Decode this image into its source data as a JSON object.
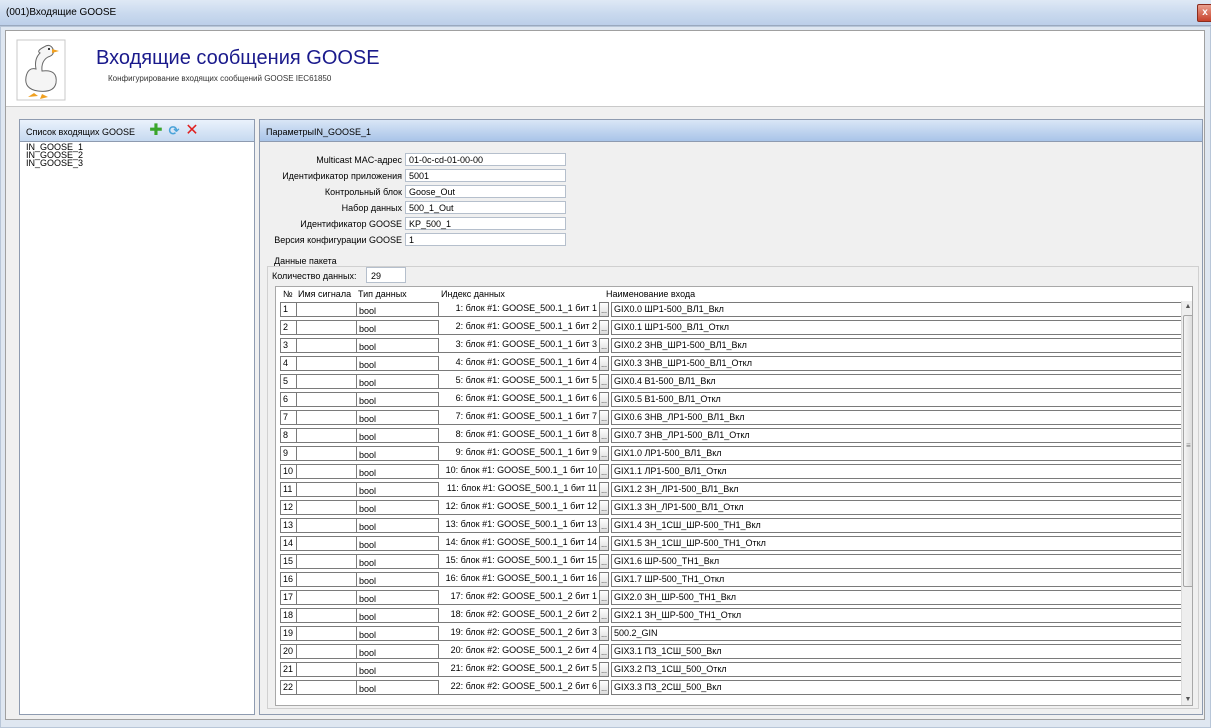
{
  "window": {
    "title": "(001)Входящие GOOSE",
    "close": "x"
  },
  "header": {
    "title": "Входящие сообщения GOOSE",
    "subtitle": "Конфигурирование входящих сообщений GOOSE IEC61850"
  },
  "left": {
    "title": "Список входящих GOOSE",
    "items": [
      "IN_GOOSE_1",
      "IN_GOOSE_2",
      "IN_GOOSE_3"
    ]
  },
  "right": {
    "title": "ПараметрыIN_GOOSE_1",
    "fields": {
      "mac": {
        "label": "Multicast MAC-адрес",
        "value": "01-0c-cd-01-00-00"
      },
      "appid": {
        "label": "Идентификатор приложения",
        "value": "5001"
      },
      "cb": {
        "label": "Контрольный блок",
        "value": "Goose_Out"
      },
      "dataset": {
        "label": "Набор данных",
        "value": "500_1_Out"
      },
      "gooseid": {
        "label": "Идентификатор GOOSE",
        "value": "KP_500_1"
      },
      "confrev": {
        "label": "Версия конфигурации GOOSE",
        "value": "1"
      }
    },
    "packet": {
      "title": "Данные пакета",
      "count_label": "Количество данных:",
      "count": "29"
    },
    "grid": {
      "headers": [
        "№",
        "Имя сигнала",
        "Тип данных",
        "Индекс данных",
        "Наименование входа"
      ],
      "btn": "...",
      "rows": [
        {
          "n": "1",
          "name": "",
          "type": "bool",
          "index": "1: блок #1: GOOSE_500.1_1 бит 1",
          "input": "GIX0.0 ШР1-500_ВЛ1_Вкл"
        },
        {
          "n": "2",
          "name": "",
          "type": "bool",
          "index": "2: блок #1: GOOSE_500.1_1 бит 2",
          "input": "GIX0.1 ШР1-500_ВЛ1_Откл"
        },
        {
          "n": "3",
          "name": "",
          "type": "bool",
          "index": "3: блок #1: GOOSE_500.1_1 бит 3",
          "input": "GIX0.2 ЗНВ_ШР1-500_ВЛ1_Вкл"
        },
        {
          "n": "4",
          "name": "",
          "type": "bool",
          "index": "4: блок #1: GOOSE_500.1_1 бит 4",
          "input": "GIX0.3 ЗНВ_ШР1-500_ВЛ1_Откл"
        },
        {
          "n": "5",
          "name": "",
          "type": "bool",
          "index": "5: блок #1: GOOSE_500.1_1 бит 5",
          "input": "GIX0.4 В1-500_ВЛ1_Вкл"
        },
        {
          "n": "6",
          "name": "",
          "type": "bool",
          "index": "6: блок #1: GOOSE_500.1_1 бит 6",
          "input": "GIX0.5 В1-500_ВЛ1_Откл"
        },
        {
          "n": "7",
          "name": "",
          "type": "bool",
          "index": "7: блок #1: GOOSE_500.1_1 бит 7",
          "input": "GIX0.6 ЗНВ_ЛР1-500_ВЛ1_Вкл"
        },
        {
          "n": "8",
          "name": "",
          "type": "bool",
          "index": "8: блок #1: GOOSE_500.1_1 бит 8",
          "input": "GIX0.7 ЗНВ_ЛР1-500_ВЛ1_Откл"
        },
        {
          "n": "9",
          "name": "",
          "type": "bool",
          "index": "9: блок #1: GOOSE_500.1_1 бит 9",
          "input": "GIX1.0 ЛР1-500_ВЛ1_Вкл"
        },
        {
          "n": "10",
          "name": "",
          "type": "bool",
          "index": "10: блок #1: GOOSE_500.1_1 бит 10",
          "input": "GIX1.1 ЛР1-500_ВЛ1_Откл"
        },
        {
          "n": "11",
          "name": "",
          "type": "bool",
          "index": "11: блок #1: GOOSE_500.1_1 бит 11",
          "input": "GIX1.2 ЗН_ЛР1-500_ВЛ1_Вкл"
        },
        {
          "n": "12",
          "name": "",
          "type": "bool",
          "index": "12: блок #1: GOOSE_500.1_1 бит 12",
          "input": "GIX1.3 ЗН_ЛР1-500_ВЛ1_Откл"
        },
        {
          "n": "13",
          "name": "",
          "type": "bool",
          "index": "13: блок #1: GOOSE_500.1_1 бит 13",
          "input": "GIX1.4 ЗН_1СШ_ШР-500_ТН1_Вкл"
        },
        {
          "n": "14",
          "name": "",
          "type": "bool",
          "index": "14: блок #1: GOOSE_500.1_1 бит 14",
          "input": "GIX1.5 ЗН_1СШ_ШР-500_ТН1_Откл"
        },
        {
          "n": "15",
          "name": "",
          "type": "bool",
          "index": "15: блок #1: GOOSE_500.1_1 бит 15",
          "input": "GIX1.6 ШР-500_ТН1_Вкл"
        },
        {
          "n": "16",
          "name": "",
          "type": "bool",
          "index": "16: блок #1: GOOSE_500.1_1 бит 16",
          "input": "GIX1.7 ШР-500_ТН1_Откл"
        },
        {
          "n": "17",
          "name": "",
          "type": "bool",
          "index": "17: блок #2: GOOSE_500.1_2 бит 1",
          "input": "GIX2.0 ЗН_ШР-500_ТН1_Вкл"
        },
        {
          "n": "18",
          "name": "",
          "type": "bool",
          "index": "18: блок #2: GOOSE_500.1_2 бит 2",
          "input": "GIX2.1 ЗН_ШР-500_ТН1_Откл"
        },
        {
          "n": "19",
          "name": "",
          "type": "bool",
          "index": "19: блок #2: GOOSE_500.1_2 бит 3",
          "input": "500.2_GIN"
        },
        {
          "n": "20",
          "name": "",
          "type": "bool",
          "index": "20: блок #2: GOOSE_500.1_2 бит 4",
          "input": "GIX3.1 ПЗ_1СШ_500_Вкл"
        },
        {
          "n": "21",
          "name": "",
          "type": "bool",
          "index": "21: блок #2: GOOSE_500.1_2 бит 5",
          "input": "GIX3.2 ПЗ_1СШ_500_Откл"
        },
        {
          "n": "22",
          "name": "",
          "type": "bool",
          "index": "22: блок #2: GOOSE_500.1_2 бит 6",
          "input": "GIX3.3 ПЗ_2СШ_500_Вкл"
        }
      ]
    }
  },
  "icons": {
    "add": "add-icon",
    "refresh": "refresh-icon",
    "delete": "delete-icon",
    "logo": "goose-logo-icon"
  },
  "colors": {
    "title": "#1a1a8c",
    "panel_header": "#a9c4e8",
    "add": "#3aa52b",
    "delete": "#e02020"
  }
}
